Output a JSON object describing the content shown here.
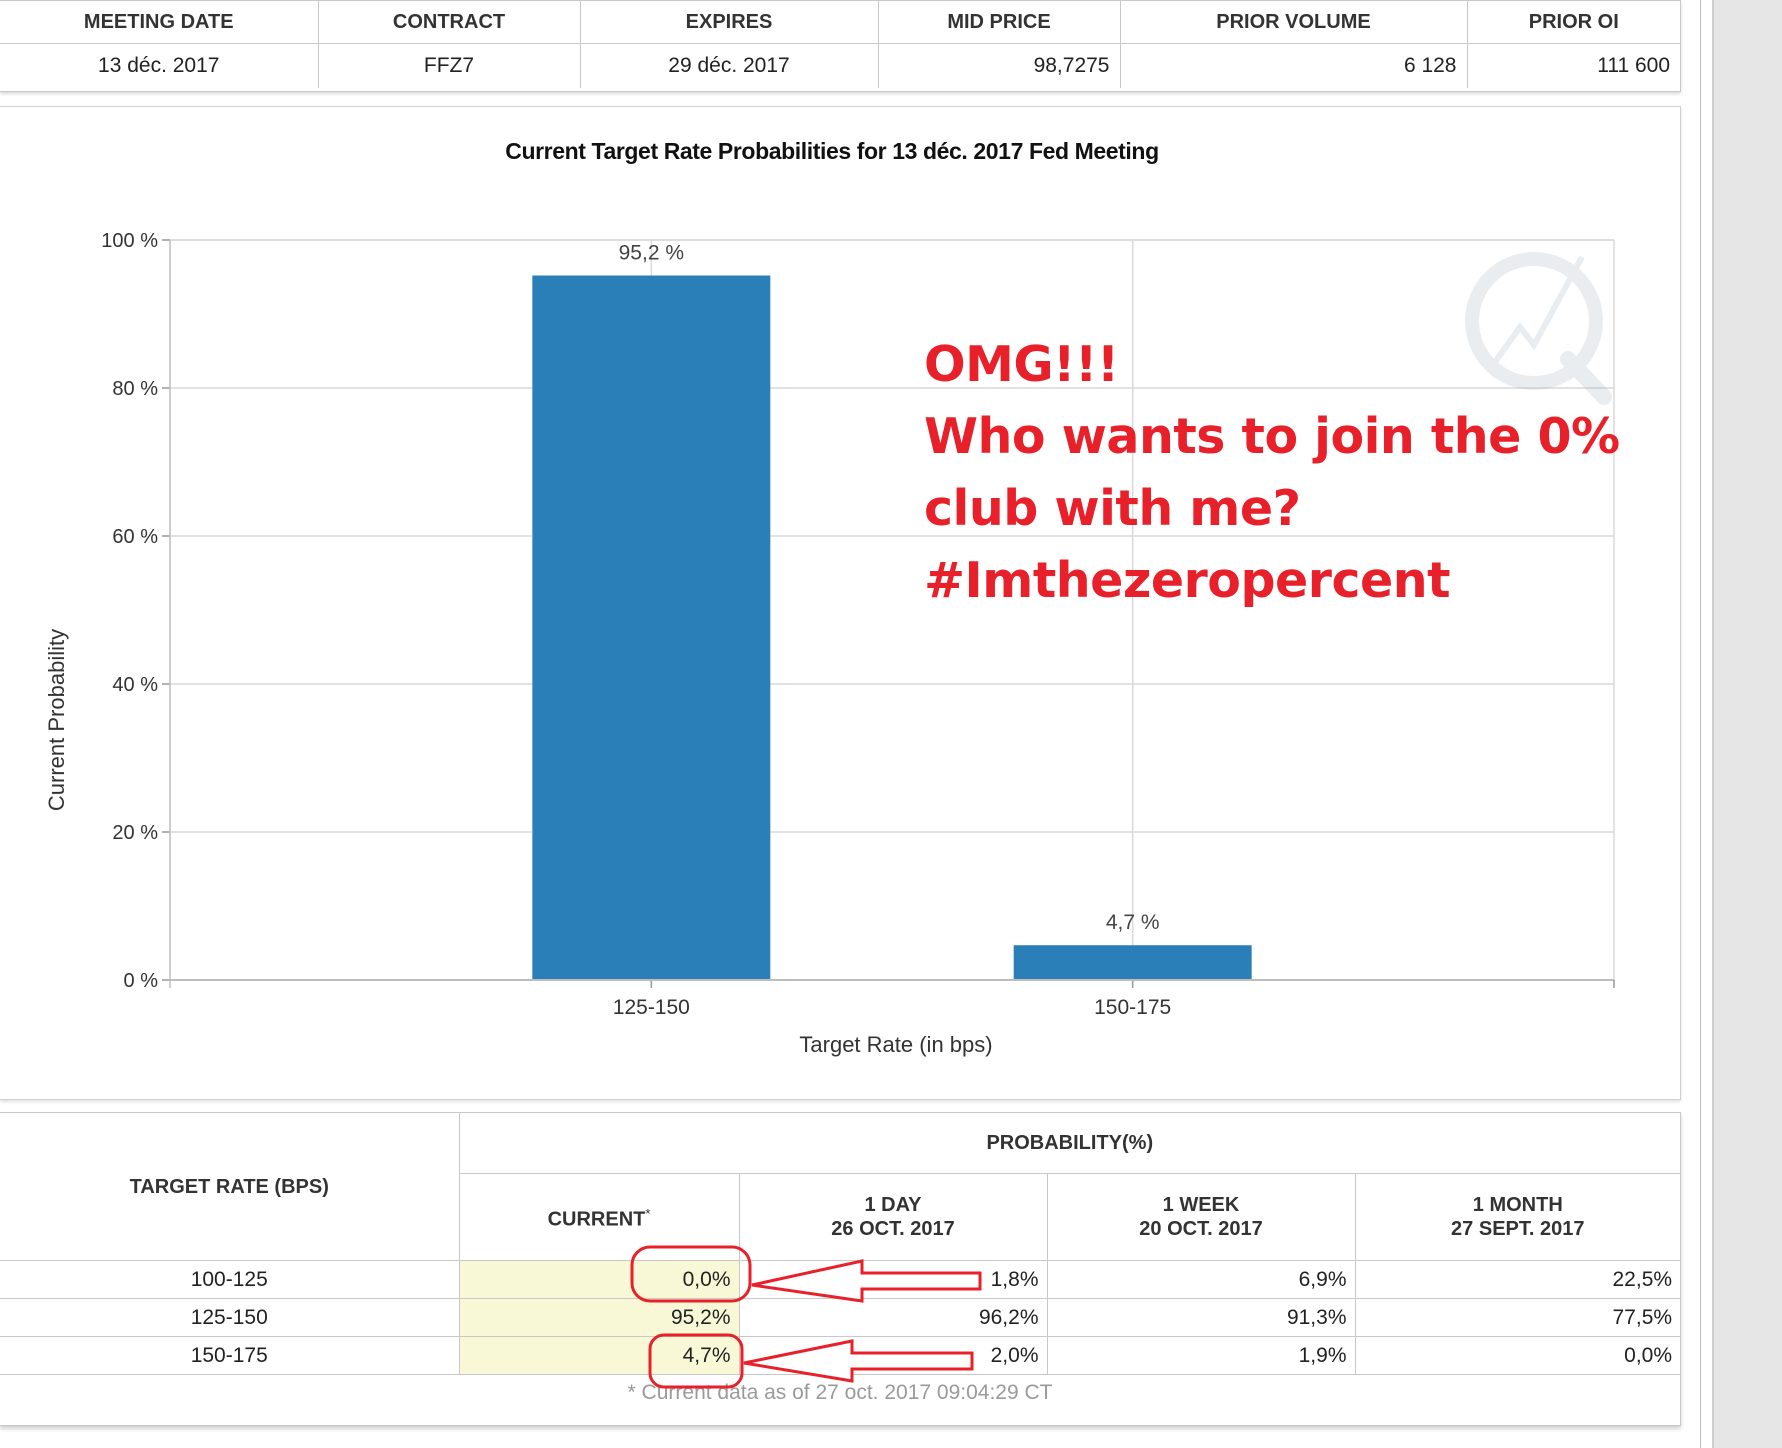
{
  "top_table": {
    "headers": [
      "MEETING DATE",
      "CONTRACT",
      "EXPIRES",
      "MID PRICE",
      "PRIOR VOLUME",
      "PRIOR OI"
    ],
    "row": {
      "meeting_date": "13 déc. 2017",
      "contract": "FFZ7",
      "expires": "29 déc. 2017",
      "mid_price": "98,7275",
      "prior_volume": "6 128",
      "prior_oi": "111 600"
    }
  },
  "chart_data": {
    "type": "bar",
    "title": "Current Target Rate Probabilities for 13 déc. 2017 Fed Meeting",
    "xlabel": "Target Rate (in bps)",
    "ylabel": "Current Probability",
    "categories": [
      "125-150",
      "150-175"
    ],
    "values": [
      95.2,
      4.7
    ],
    "data_labels": [
      "95,2 %",
      "4,7 %"
    ],
    "ylim": [
      0,
      100
    ],
    "yticks": [
      0,
      20,
      40,
      60,
      80,
      100
    ],
    "ytick_labels": [
      "0 %",
      "20 %",
      "40 %",
      "60 %",
      "80 %",
      "100 %"
    ],
    "bar_color": "#2b7fb8",
    "grid": true,
    "legend": "none"
  },
  "annotation": {
    "lines": [
      "OMG!!!",
      "Who wants to join the 0%",
      "club with me?",
      "#Imthezeropercent"
    ],
    "color": "#e8202a"
  },
  "prob_table": {
    "target_rate_header": "TARGET RATE (BPS)",
    "probability_header": "PROBABILITY(%)",
    "current_label": "CURRENT",
    "current_marker": "*",
    "day_label": "1 DAY",
    "day_date": "26 OCT. 2017",
    "week_label": "1 WEEK",
    "week_date": "20 OCT. 2017",
    "month_label": "1 MONTH",
    "month_date": "27 SEPT. 2017",
    "rows": [
      {
        "rate": "100-125",
        "current": "0,0%",
        "day": "1,8%",
        "week": "6,9%",
        "month": "22,5%"
      },
      {
        "rate": "125-150",
        "current": "95,2%",
        "day": "96,2%",
        "week": "91,3%",
        "month": "77,5%"
      },
      {
        "rate": "150-175",
        "current": "4,7%",
        "day": "2,0%",
        "week": "1,9%",
        "month": "0,0%"
      }
    ],
    "footnote": "* Current data as of 27 oct. 2017 09:04:29 CT"
  },
  "colors": {
    "highlight_red": "#e8202a",
    "current_cell_bg": "#f8f8d6",
    "grid": "#d9d9d9"
  }
}
